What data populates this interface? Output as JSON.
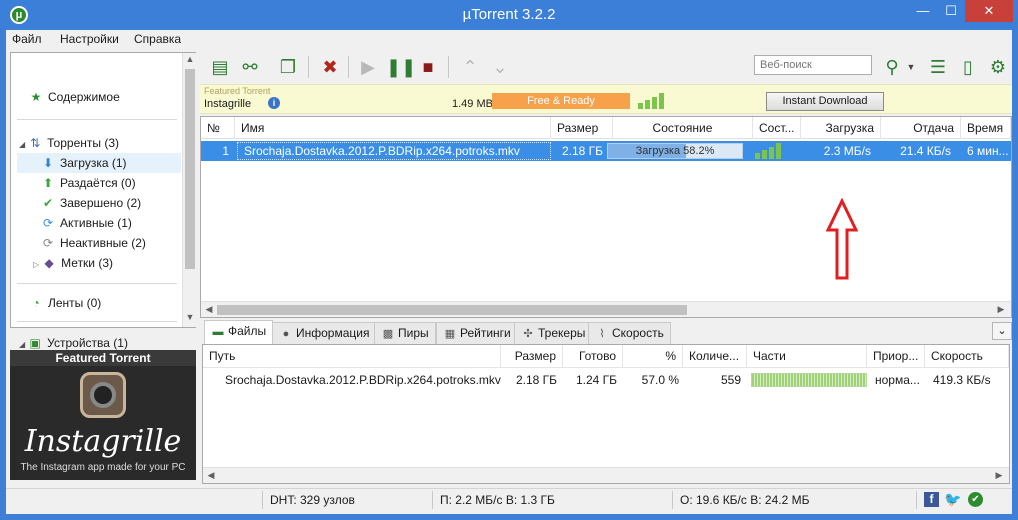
{
  "window": {
    "title": "µTorrent 3.2.2",
    "app_icon": "μ",
    "min": "—",
    "max": "☐",
    "close": "✕"
  },
  "menu": [
    "Файл",
    "Настройки",
    "Справка"
  ],
  "sidebar": {
    "content": "Содержимое",
    "torrents": "Торренты (3)",
    "downloading": "Загрузка (1)",
    "seeding": "Раздаётся (0)",
    "completed": "Завершено (2)",
    "active": "Активные (1)",
    "inactive": "Неактивные (2)",
    "labels": "Метки (3)",
    "feeds": "Ленты (0)",
    "devices": "Устройства (1)"
  },
  "ad": {
    "header": "Featured Torrent",
    "name": "Instagrille",
    "tagline": "The Instagram app made for your PC"
  },
  "toolbar": {
    "search_placeholder": "Веб-поиск"
  },
  "featured": {
    "label": "Featured Torrent",
    "name": "Instagrille",
    "size": "1.49 MB",
    "status": "Free & Ready",
    "button": "Instant Download",
    "signal_levels": [
      0.35,
      0.55,
      0.75,
      1.0
    ]
  },
  "torrent_columns": {
    "num": "№",
    "name": "Имя",
    "size": "Размер",
    "status": "Состояние",
    "health": "Сост...",
    "down": "Загрузка",
    "up": "Отдача",
    "eta": "Время"
  },
  "torrents": [
    {
      "num": "1",
      "name": "Srochaja.Dostavka.2012.P.BDRip.x264.potroks.mkv",
      "size": "2.18 ГБ",
      "status": "Загрузка 58.2%",
      "progress": 0.582,
      "down": "2.3 МБ/s",
      "up": "21.4 КБ/s",
      "eta": "6 мин..."
    }
  ],
  "tabs": {
    "files": "Файлы",
    "info": "Информация",
    "peers": "Пиры",
    "ratings": "Рейтинги",
    "trackers": "Трекеры",
    "speed": "Скорость"
  },
  "file_columns": {
    "path": "Путь",
    "size": "Размер",
    "done": "Готово",
    "pct": "%",
    "count": "Количе...",
    "pieces": "Части",
    "priority": "Приор...",
    "speed": "Скорость"
  },
  "files": [
    {
      "path": "Srochaja.Dostavka.2012.P.BDRip.x264.potroks.mkv",
      "size": "2.18 ГБ",
      "done": "1.24 ГБ",
      "pct": "57.0 %",
      "count": "559",
      "priority": "норма...",
      "speed": "419.3 КБ/s"
    }
  ],
  "status": {
    "dht": "DHT: 329 узлов",
    "download": "П: 2.2 МБ/с В: 1.3 ГБ",
    "upload": "О: 19.6 КБ/с В: 24.2 МБ"
  },
  "colors": {
    "accent": "#3c7fd9",
    "selection": "#3a8ee6",
    "arrow": "#e02020",
    "ready": "#f7a14b"
  }
}
